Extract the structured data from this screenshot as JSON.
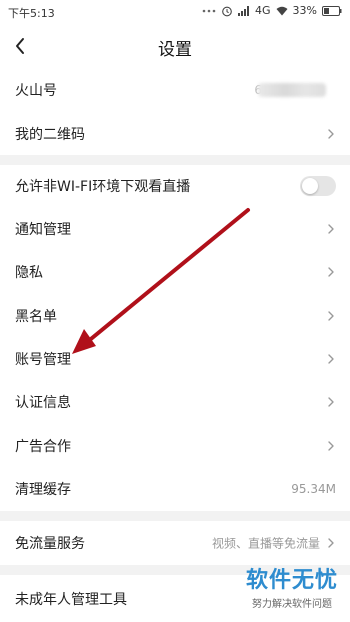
{
  "status_bar": {
    "time": "下午5:13",
    "network": "4G",
    "battery": "33%"
  },
  "header": {
    "title": "设置",
    "back_icon": "chevron-left-icon"
  },
  "settings": {
    "huoshan_id": {
      "label": "火山号",
      "value": "6"
    },
    "qr_code": {
      "label": "我的二维码"
    },
    "allow_non_wifi_live": {
      "label": "允许非WI-FI环境下观看直播",
      "enabled": false
    },
    "notifications": {
      "label": "通知管理"
    },
    "privacy": {
      "label": "隐私"
    },
    "blacklist": {
      "label": "黑名单"
    },
    "account": {
      "label": "账号管理"
    },
    "verification": {
      "label": "认证信息"
    },
    "ad_partnership": {
      "label": "广告合作"
    },
    "clear_cache": {
      "label": "清理缓存",
      "value": "95.34M"
    },
    "free_data": {
      "label": "免流量服务",
      "value": "视频、直播等免流量"
    },
    "minor_tools": {
      "label": "未成年人管理工具"
    }
  },
  "watermark": {
    "main": "软件无忧",
    "sub": "努力解决软件问题"
  },
  "colors": {
    "annotation_arrow": "#b0101a",
    "watermark": "#2e8ccf",
    "section_gap": "#f2f2f2"
  }
}
